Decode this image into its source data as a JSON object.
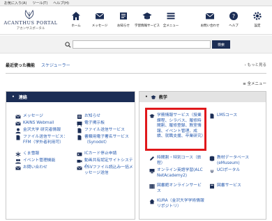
{
  "browser_menu": [
    "お気に入り(A)",
    "ツール(T)",
    "ヘルプ(H)"
  ],
  "logo": {
    "title": "ACANTHUS PORTAL",
    "subtitle": "アカンサスポータル"
  },
  "nav": [
    {
      "label": "ホーム",
      "icon": "home-icon"
    },
    {
      "label": "メッセージ",
      "icon": "mail-icon"
    },
    {
      "label": "お知らせ",
      "icon": "notice-icon"
    },
    {
      "label": "学習情報サービス",
      "icon": "graduation-cap-icon"
    },
    {
      "label": "全メニュー",
      "icon": "menu-icon"
    }
  ],
  "nav_right": [
    {
      "label": "お問い合わせ",
      "icon": "envelope-icon"
    },
    {
      "label": "ヘルプ",
      "icon": "help-icon"
    },
    {
      "label": "設定",
      "icon": "gear-icon"
    }
  ],
  "search": {
    "placeholder": "",
    "button": "検索"
  },
  "recent": {
    "label": "最近使った機能",
    "link": "スケジューラー",
    "more": "もっと見る"
  },
  "all_menu": "全メニュー",
  "panels": {
    "left": {
      "title": "連絡",
      "col1": [
        "メッセージ",
        "KAINS Webmail",
        "金沢大学 研究者情報",
        "ファイル送信サービス：FFM（学外者利用可）",
        "くま雪報",
        "イベント管理機能",
        "お問い合わせ"
      ],
      "col2": [
        "お知らせ",
        "電子掲示板",
        "ファイル送信サービス",
        "書類用電子署名サービス（Synodot）",
        "ICカード停止申請",
        "動画共有認定サイトシステム",
        "CSVファイル読込み一括メッセージ送信"
      ]
    },
    "right": {
      "title": "教学",
      "col1": [
        "学務情報サービス（授業課程、シラバス、履修時間割、履修登録、教室情報、イベント管理、成績、就職支援、卒業研究）",
        "時間割・特別コース（旅程）",
        "オンライン英語学習(ALC NetAcademy2)",
        "図書館オンラインサービス",
        "KURA（金沢大学学術情報リポジトリ）"
      ],
      "col2": [
        "LMSコース",
        "教材データベース(eMuseum)",
        "UCIポータル",
        "図書サービス"
      ]
    }
  }
}
